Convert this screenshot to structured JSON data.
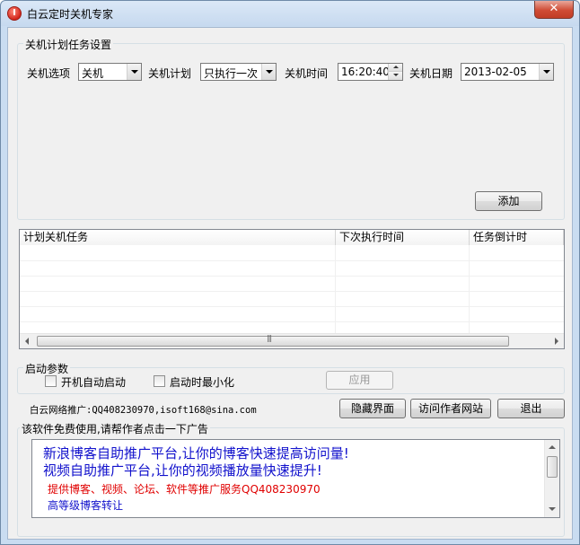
{
  "window": {
    "title": "白云定时关机专家",
    "close_label": "✕"
  },
  "schedule": {
    "legend": "关机计划任务设置",
    "option_label": "关机选项",
    "option_value": "关机",
    "plan_label": "关机计划",
    "plan_value": "只执行一次",
    "time_label": "关机时间",
    "time_value": "16:20:40",
    "date_label": "关机日期",
    "date_value": "2013-02-05",
    "add_button": "添加"
  },
  "tasks": {
    "columns": [
      "计划关机任务",
      "下次执行时间",
      "任务倒计时"
    ],
    "rows": []
  },
  "startup": {
    "legend": "启动参数",
    "auto_start_label": "开机自动启动",
    "auto_start_checked": false,
    "start_minimized_label": "启动时最小化",
    "start_minimized_checked": false,
    "apply_button": "应用"
  },
  "promo": "白云网络推广:QQ408230970,isoft168@sina.com",
  "buttons": {
    "hide": "隐藏界面",
    "visit": "访问作者网站",
    "exit": "退出"
  },
  "ad": {
    "legend": "该软件免费使用,请帮作者点击一下广告",
    "line1": "新浪博客自助推广平台,让你的博客快速提高访问量!",
    "line2": "视频自助推广平台,让你的视频播放量快速提升!",
    "line3": "提供博客、视频、论坛、软件等推广服务QQ408230970",
    "line4": "高等级博客转让",
    "line1_color": "#1111cc",
    "line3_color": "#e00000",
    "line4_color": "#1111cc"
  }
}
